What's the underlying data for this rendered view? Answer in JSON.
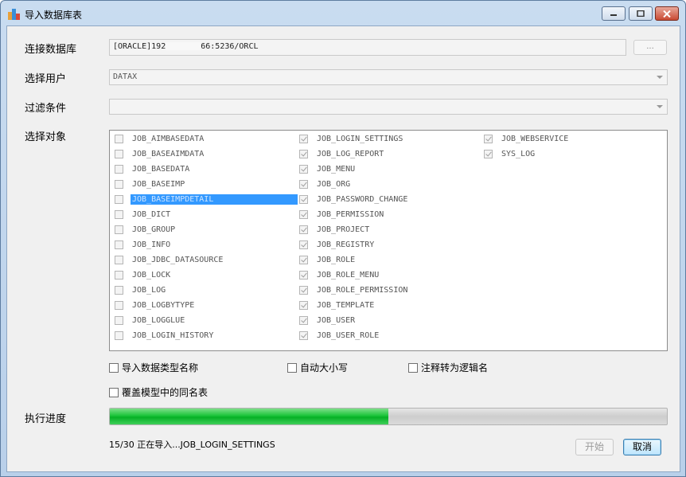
{
  "window": {
    "title": "导入数据库表"
  },
  "form": {
    "connection_label": "连接数据库",
    "connection_value_prefix": "[ORACLE]192",
    "connection_value_suffix": "66:5236/ORCL",
    "browse_label": "...",
    "user_label": "选择用户",
    "user_value": "DATAX",
    "filter_label": "过滤条件",
    "filter_value": "",
    "objects_label": "选择对象",
    "progress_label": "执行进度"
  },
  "objects": {
    "col1": [
      {
        "name": "JOB_AIMBASEDATA",
        "checked": false
      },
      {
        "name": "JOB_BASEAIMDATA",
        "checked": false
      },
      {
        "name": "JOB_BASEDATA",
        "checked": false
      },
      {
        "name": "JOB_BASEIMP",
        "checked": false
      },
      {
        "name": "JOB_BASEIMPDETAIL",
        "checked": false,
        "selected": true
      },
      {
        "name": "JOB_DICT",
        "checked": false
      },
      {
        "name": "JOB_GROUP",
        "checked": false
      },
      {
        "name": "JOB_INFO",
        "checked": false
      },
      {
        "name": "JOB_JDBC_DATASOURCE",
        "checked": false
      },
      {
        "name": "JOB_LOCK",
        "checked": false
      },
      {
        "name": "JOB_LOG",
        "checked": false
      },
      {
        "name": "JOB_LOGBYTYPE",
        "checked": false
      },
      {
        "name": "JOB_LOGGLUE",
        "checked": false
      },
      {
        "name": "JOB_LOGIN_HISTORY",
        "checked": false
      }
    ],
    "col2": [
      {
        "name": "JOB_LOGIN_SETTINGS",
        "checked": true
      },
      {
        "name": "JOB_LOG_REPORT",
        "checked": true
      },
      {
        "name": "JOB_MENU",
        "checked": true
      },
      {
        "name": "JOB_ORG",
        "checked": true
      },
      {
        "name": "JOB_PASSWORD_CHANGE",
        "checked": true
      },
      {
        "name": "JOB_PERMISSION",
        "checked": true
      },
      {
        "name": "JOB_PROJECT",
        "checked": true
      },
      {
        "name": "JOB_REGISTRY",
        "checked": true
      },
      {
        "name": "JOB_ROLE",
        "checked": true
      },
      {
        "name": "JOB_ROLE_MENU",
        "checked": true
      },
      {
        "name": "JOB_ROLE_PERMISSION",
        "checked": true
      },
      {
        "name": "JOB_TEMPLATE",
        "checked": true
      },
      {
        "name": "JOB_USER",
        "checked": true
      },
      {
        "name": "JOB_USER_ROLE",
        "checked": true
      }
    ],
    "col3": [
      {
        "name": "JOB_WEBSERVICE",
        "checked": true
      },
      {
        "name": "SYS_LOG",
        "checked": true
      }
    ]
  },
  "options": {
    "import_type_names": "导入数据类型名称",
    "auto_case": "自动大小写",
    "comment_to_logical": "注释转为逻辑名",
    "overwrite_same_name": "覆盖模型中的同名表"
  },
  "progress": {
    "fraction": 0.5,
    "status": "15/30 正在导入...JOB_LOGIN_SETTINGS"
  },
  "buttons": {
    "start": "开始",
    "cancel": "取消"
  },
  "colors": {
    "selection": "#3399ff",
    "progress_fill": "#06b025"
  }
}
